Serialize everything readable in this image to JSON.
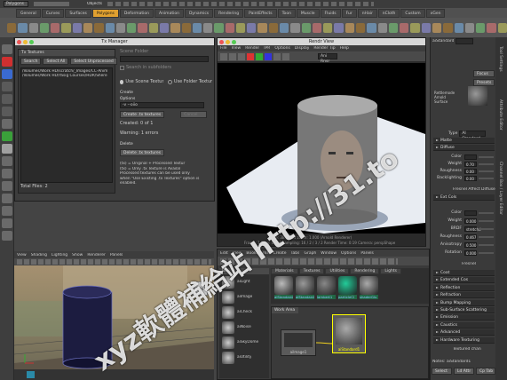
{
  "menubar": {
    "workspace": "Polygons",
    "objects_label": "Objects"
  },
  "shelf_tabs": [
    "General",
    "Curves",
    "Surfaces",
    "Polygons",
    "Deformation",
    "Animation",
    "Dynamics",
    "Rendering",
    "PaintEffects",
    "Toon",
    "Muscle",
    "Fluids",
    "Fur",
    "nHair",
    "nCloth",
    "Custom",
    "xGen"
  ],
  "shelf_active": "Polygons",
  "tx_manager": {
    "title": "Tx Manager",
    "textures_header": "Tx Textures",
    "search_btn": "Search",
    "select_all_btn": "Select All",
    "select_unprocessed_btn": "Select Unprocessed",
    "scene_folder": "Scene Folder",
    "search_in_subfolders": "Search in subfolders",
    "files": [
      "/Volumes/Work HD/scratch/_Images/CC-Anim",
      "/Volumes/Work HD/Yasig Courses/HDR/Shere"
    ],
    "use_scene_textures": "Use Scene Textures",
    "use_folder_textures": "Use Folder Textures",
    "create_header": "Create",
    "options_label": "Options",
    "options_value": "-v --oiio",
    "create_tx_btn": "Create .tx textures",
    "cancel_btn": "Cancel",
    "created": "Created: 0 of 1",
    "warning": "Warning: 1 errors",
    "delete_header": "Delete",
    "delete_tx_btn": "Delete .tx textures",
    "total_files": "Total Files: 2",
    "legend": [
      "(tx) = Original + Processed Textur",
      "(tx) = Only .tx Texture is Availal",
      "Processed textures can be used only",
      "when \"Use Existing .tx Textures\" option is",
      "enabled."
    ]
  },
  "render_view": {
    "title": "Rendr View",
    "menu": [
      "File",
      "View",
      "Render",
      "IPR",
      "Options",
      "Display",
      "Render Tip",
      "Help"
    ],
    "camera_value": "Ani Rnsr",
    "status1": "size: 3B x 164 zoom: 1.000 (Arnold Renderer)",
    "status2": "Frame: 1 Step: 0P 18 Lampling: 16 / 2 / 3 / 2 Render Time: 0:19 Camera: perspShape"
  },
  "viewport": {
    "menu": [
      "View",
      "Shading",
      "Lighting",
      "Show",
      "Renderer",
      "Panels"
    ],
    "cube_label": "FRONT"
  },
  "hypershade": {
    "menu": [
      "Edit",
      "View",
      "Bookmarks",
      "Create",
      "Tabs",
      "Graph",
      "Window",
      "Options",
      "Panels"
    ],
    "tabs": [
      "Materials",
      "Textures",
      "Utilities",
      "Rendering",
      "Lights"
    ],
    "swatches": [
      "aiStandarda",
      "aiStandardb",
      "lambert1",
      "particleCl",
      "shaderGlu"
    ],
    "create_items": [
      "aiLight",
      "aiImage",
      "aiCheck",
      "aiNoise",
      "aiSkyDome",
      "aiUtility"
    ],
    "create_header": "Bin",
    "work_area": "Work Area",
    "node_left": "aiImage1",
    "node_right": "aiStandard1"
  },
  "attribute_editor": {
    "node_name": "aiStandard",
    "focus_btn": "Focus",
    "presets_btn": "Presets",
    "show_btn": "Show",
    "hide_btn": "Hide",
    "sample_caption": [
      "Rettlemode",
      "Arnold",
      "Surface"
    ],
    "type_label": "Type",
    "type_value": "AI Standard",
    "sections": [
      "Matte",
      "Diffuse",
      "Ext Cols",
      "Coat",
      "Extended Cos",
      "Reflection",
      "Refraction",
      "Bump Mapping",
      "Sub-Surface Scattering",
      "Emission",
      "Caustics",
      "Advanced",
      "Hardware Texturing"
    ],
    "diffuse": [
      {
        "k": "Color",
        "v": ""
      },
      {
        "k": "Weight",
        "v": "0.70"
      },
      {
        "k": "Roughness",
        "v": "0.00"
      },
      {
        "k": "Backlighting",
        "v": "0.00"
      }
    ],
    "fresnel_cb": "Fresnel Affect Diffuse",
    "spec": [
      {
        "k": "Color",
        "v": ""
      },
      {
        "k": "Weight",
        "v": "0.000"
      },
      {
        "k": "BRDF",
        "v": "stretchd"
      },
      {
        "k": "Roughness",
        "v": "0.467"
      },
      {
        "k": "Anisotropy",
        "v": "0.500"
      },
      {
        "k": "Rotation",
        "v": "0.000"
      }
    ],
    "fresnel_label": "Fresnel",
    "textured_label": "Textured chan",
    "notes": "Notes: aiStandard1",
    "select_btn": "Select",
    "load_btn": "Ld Attr",
    "copy_btn": "Cp Tab"
  },
  "side_tabs": [
    "Tool Settings",
    "Attribute Editor",
    "Channel Box / Layer Editor",
    "Outliner"
  ],
  "watermark": "xyz軟體補給站 http://31.to",
  "colors": {
    "accent": "#e0a030",
    "panel": "#3d3d3d",
    "title": "#d8d8d8"
  }
}
